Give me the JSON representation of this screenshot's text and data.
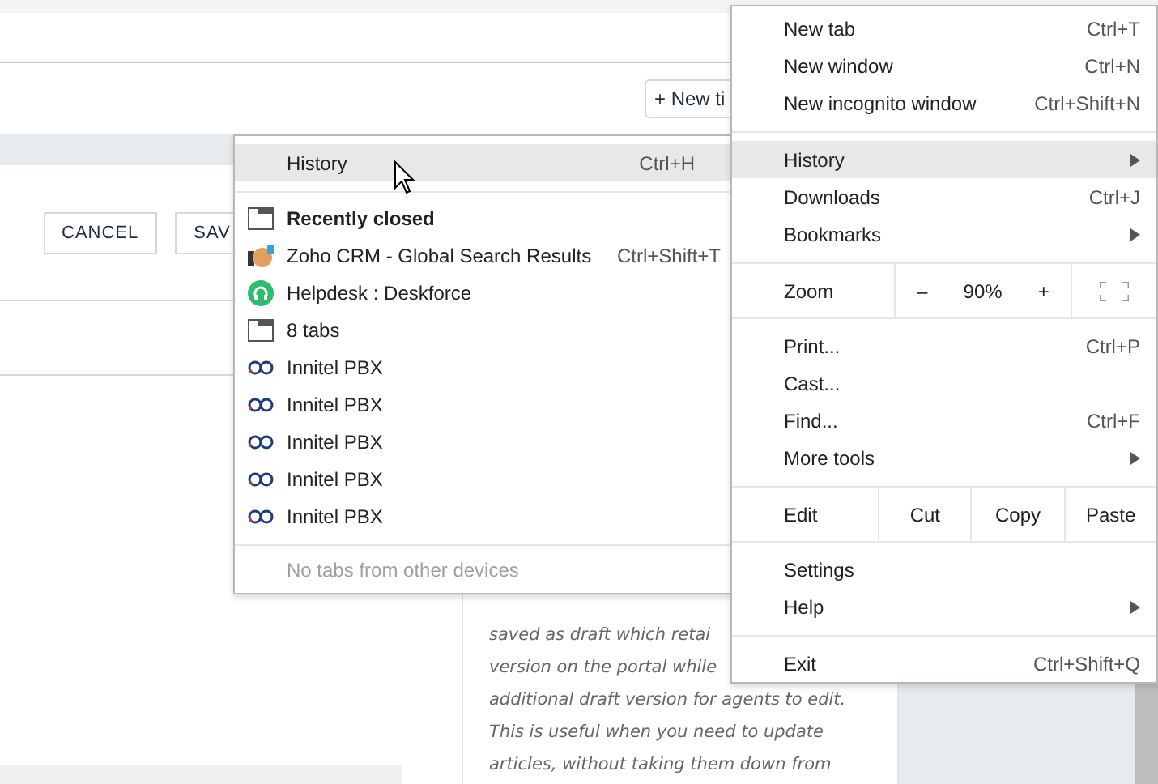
{
  "page": {
    "new_button": "+ New ti",
    "form_buttons": [
      "CANCEL",
      "SAV"
    ],
    "article_lines": [
      "saved as draft which retai",
      "version on the portal while",
      "additional draft version for agents to edit.",
      "This is useful when you need to update",
      "articles, without taking them down from"
    ]
  },
  "history_submenu": {
    "title": "History",
    "shortcut": "Ctrl+H",
    "selected": true,
    "items": [
      {
        "kind": "window",
        "label": "Recently closed",
        "bold": true
      },
      {
        "kind": "crm",
        "label": "Zoho CRM - Global Search Results",
        "shortcut": "Ctrl+Shift+T",
        "bold": false
      },
      {
        "kind": "helpdesk",
        "label": "Helpdesk : Deskforce",
        "bold": false
      },
      {
        "kind": "window",
        "label": "8 tabs",
        "bold": false
      },
      {
        "kind": "pbx",
        "label": "Innitel PBX",
        "bold": false
      },
      {
        "kind": "pbx",
        "label": "Innitel PBX",
        "bold": false
      },
      {
        "kind": "pbx",
        "label": "Innitel PBX",
        "bold": false
      },
      {
        "kind": "pbx",
        "label": "Innitel PBX",
        "bold": false
      },
      {
        "kind": "pbx",
        "label": "Innitel PBX",
        "bold": false
      }
    ],
    "footer": "No tabs from other devices"
  },
  "main_menu": {
    "sections": [
      [
        {
          "kind": "item",
          "label": "New tab",
          "shortcut": "Ctrl+T",
          "submenu": false,
          "selected": false
        },
        {
          "kind": "item",
          "label": "New window",
          "shortcut": "Ctrl+N",
          "submenu": false,
          "selected": false
        },
        {
          "kind": "item",
          "label": "New incognito window",
          "shortcut": "Ctrl+Shift+N",
          "submenu": false,
          "selected": false
        }
      ],
      [
        {
          "kind": "item",
          "label": "History",
          "submenu": true,
          "selected": true
        },
        {
          "kind": "item",
          "label": "Downloads",
          "shortcut": "Ctrl+J",
          "submenu": false,
          "selected": false
        },
        {
          "kind": "item",
          "label": "Bookmarks",
          "submenu": true,
          "selected": false
        }
      ],
      [
        {
          "kind": "zoom",
          "label": "Zoom",
          "minus": "–",
          "value": "90%",
          "plus": "+"
        }
      ],
      [
        {
          "kind": "item",
          "label": "Print...",
          "shortcut": "Ctrl+P",
          "submenu": false,
          "selected": false
        },
        {
          "kind": "item",
          "label": "Cast...",
          "submenu": false,
          "selected": false
        },
        {
          "kind": "item",
          "label": "Find...",
          "shortcut": "Ctrl+F",
          "submenu": false,
          "selected": false
        },
        {
          "kind": "item",
          "label": "More tools",
          "submenu": true,
          "selected": false
        }
      ],
      [
        {
          "kind": "edit",
          "label": "Edit",
          "actions": [
            "Cut",
            "Copy",
            "Paste"
          ]
        }
      ],
      [
        {
          "kind": "item",
          "label": "Settings",
          "submenu": false,
          "selected": false
        },
        {
          "kind": "item",
          "label": "Help",
          "submenu": true,
          "selected": false
        }
      ],
      [
        {
          "kind": "item",
          "label": "Exit",
          "shortcut": "Ctrl+Shift+Q",
          "submenu": false,
          "selected": false
        }
      ]
    ]
  }
}
